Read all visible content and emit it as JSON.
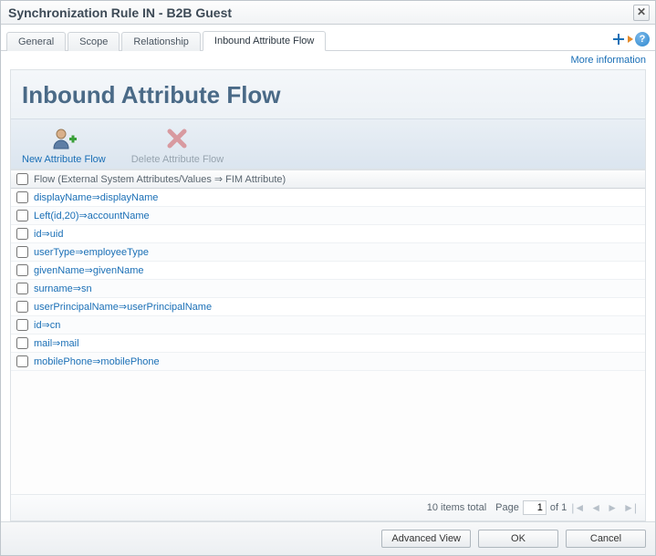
{
  "window": {
    "title": "Synchronization Rule IN - B2B Guest"
  },
  "tabs": {
    "general": "General",
    "scope": "Scope",
    "relationship": "Relationship",
    "inbound": "Inbound Attribute Flow"
  },
  "links": {
    "more_info": "More information"
  },
  "heading": "Inbound Attribute Flow",
  "actions": {
    "new": "New Attribute Flow",
    "delete": "Delete Attribute Flow"
  },
  "grid": {
    "header": "Flow (External System Attributes/Values ⇒ FIM Attribute)",
    "rows": [
      "displayName⇒displayName",
      "Left(id,20)⇒accountName",
      "id⇒uid",
      "userType⇒employeeType",
      "givenName⇒givenName",
      "surname⇒sn",
      "userPrincipalName⇒userPrincipalName",
      "id⇒cn",
      "mail⇒mail",
      "mobilePhone⇒mobilePhone"
    ]
  },
  "footer": {
    "items_total": "10 items total",
    "page_label": "Page",
    "page_value": "1",
    "of_label": "of 1"
  },
  "buttons": {
    "advanced": "Advanced View",
    "ok": "OK",
    "cancel": "Cancel"
  }
}
